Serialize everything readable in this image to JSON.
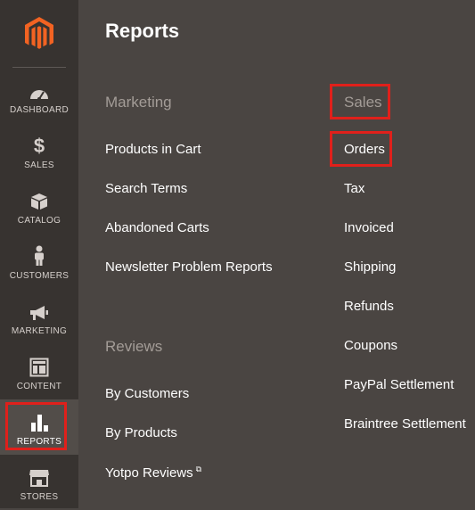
{
  "sidebar": {
    "items": [
      {
        "label": "Dashboard",
        "icon": "dashboard-icon"
      },
      {
        "label": "Sales",
        "icon": "dollar-icon"
      },
      {
        "label": "Catalog",
        "icon": "box-icon"
      },
      {
        "label": "Customers",
        "icon": "person-icon"
      },
      {
        "label": "Marketing",
        "icon": "megaphone-icon"
      },
      {
        "label": "Content",
        "icon": "layout-icon"
      },
      {
        "label": "Reports",
        "icon": "bar-chart-icon"
      },
      {
        "label": "Stores",
        "icon": "store-icon"
      }
    ],
    "active": "Reports"
  },
  "main": {
    "title": "Reports",
    "marketing": {
      "title": "Marketing",
      "links": [
        "Products in Cart",
        "Search Terms",
        "Abandoned Carts",
        "Newsletter Problem Reports"
      ]
    },
    "reviews": {
      "title": "Reviews",
      "links": [
        "By Customers",
        "By Products",
        "Yotpo Reviews"
      ]
    },
    "sales": {
      "title": "Sales",
      "links": [
        "Orders",
        "Tax",
        "Invoiced",
        "Shipping",
        "Refunds",
        "Coupons",
        "PayPal Settlement",
        "Braintree Settlement"
      ]
    }
  },
  "colors": {
    "sidebar_bg": "#373330",
    "main_bg": "#4a4542",
    "logo_orange": "#f26322",
    "highlight_red": "#e0201b",
    "section_title": "#a39c97"
  }
}
